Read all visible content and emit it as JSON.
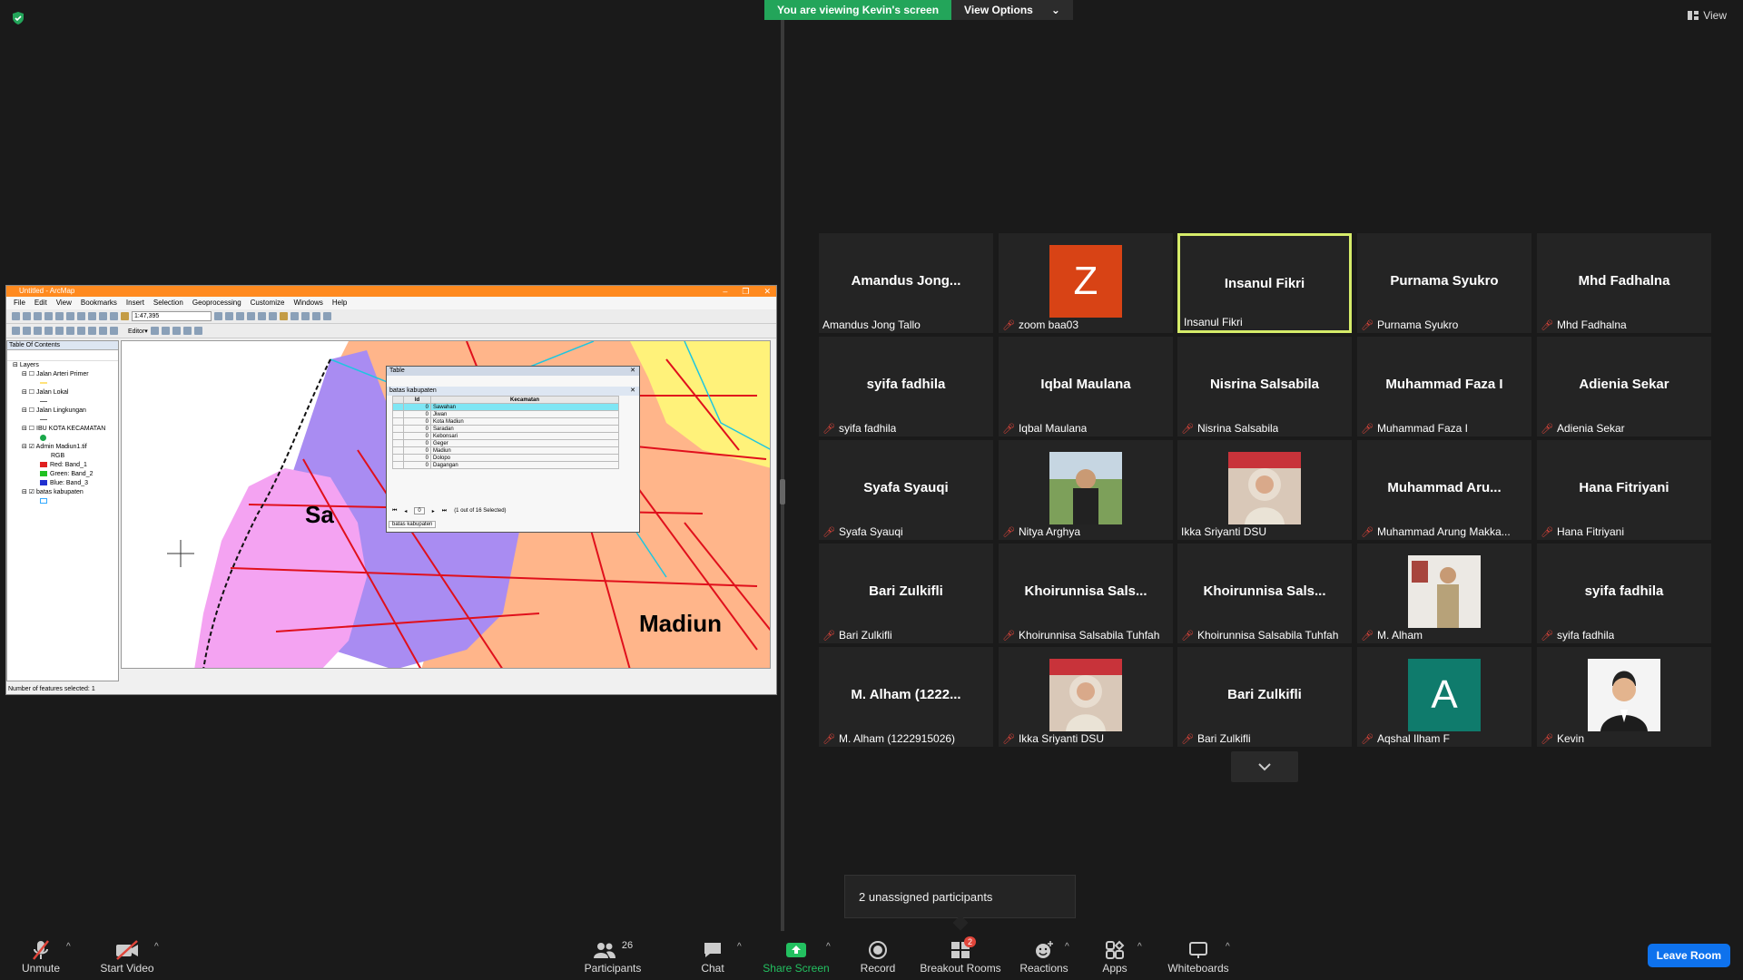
{
  "top": {
    "banner_text": "You are viewing Kevin's screen",
    "view_options": "View Options",
    "view_button": "View"
  },
  "arcmap": {
    "title": "Untitled - ArcMap",
    "menus": [
      "File",
      "Edit",
      "View",
      "Bookmarks",
      "Insert",
      "Selection",
      "Geoprocessing",
      "Customize",
      "Windows",
      "Help"
    ],
    "scale": "1:47,395",
    "editor": "Editor▾",
    "toc_title": "Table Of Contents",
    "toc": [
      "Layers",
      "Jalan Arteri Primer",
      "Jalan Lokal",
      "Jalan Lingkungan",
      "IBU KOTA KECAMATAN",
      "Admin Madiun1.tif",
      "RGB",
      "Red:   Band_1",
      "Green: Band_2",
      "Blue:  Band_3",
      "batas kabupaten"
    ],
    "map_labels": [
      "Sa",
      "Madiun"
    ],
    "status": "Number of features selected: 1",
    "table": {
      "title": "Table",
      "layer": "batas kabupaten",
      "headers": [
        "Id",
        "Kecamatan"
      ],
      "rows": [
        {
          "id": "0",
          "name": "Sawahan"
        },
        {
          "id": "0",
          "name": "Jiwan"
        },
        {
          "id": "0",
          "name": "Kota Madiun"
        },
        {
          "id": "0",
          "name": "Saradan"
        },
        {
          "id": "0",
          "name": "Kebonsari"
        },
        {
          "id": "0",
          "name": "Geger"
        },
        {
          "id": "0",
          "name": "Madiun"
        },
        {
          "id": "0",
          "name": "Dolopo"
        },
        {
          "id": "0",
          "name": "Dagangan"
        }
      ],
      "page_value": "0",
      "selection": "(1 out of 16 Selected)",
      "tab": "batas kabupaten"
    }
  },
  "participants": [
    {
      "big": "Amandus  Jong...",
      "name": "Amandus Jong Tallo",
      "muted": false,
      "type": "name"
    },
    {
      "big": "Z",
      "name": "zoom baa03",
      "muted": true,
      "type": "avatar",
      "color": "#d84315"
    },
    {
      "big": "Insanul Fikri",
      "name": "Insanul Fikri",
      "muted": false,
      "type": "name",
      "active": true
    },
    {
      "big": "Purnama Syukro",
      "name": "Purnama Syukro",
      "muted": true,
      "type": "name"
    },
    {
      "big": "Mhd Fadhalna",
      "name": "Mhd Fadhalna",
      "muted": true,
      "type": "name"
    },
    {
      "big": "syifa fadhila",
      "name": "syifa fadhila",
      "muted": true,
      "type": "name"
    },
    {
      "big": "Iqbal Maulana",
      "name": "Iqbal Maulana",
      "muted": true,
      "type": "name"
    },
    {
      "big": "Nisrina Salsabila",
      "name": "Nisrina Salsabila",
      "muted": true,
      "type": "name"
    },
    {
      "big": "Muhammad Faza I",
      "name": "Muhammad Faza I",
      "muted": true,
      "type": "name"
    },
    {
      "big": "Adienia Sekar",
      "name": "Adienia Sekar",
      "muted": true,
      "type": "name"
    },
    {
      "big": "Syafa Syauqi",
      "name": "Syafa Syauqi",
      "muted": true,
      "type": "name"
    },
    {
      "big": "",
      "name": "Nitya Arghya",
      "muted": true,
      "type": "photo",
      "photo": "outdoor"
    },
    {
      "big": "",
      "name": "Ikka Sriyanti DSU",
      "muted": false,
      "type": "photo",
      "photo": "hijab"
    },
    {
      "big": "Muhammad  Aru...",
      "name": "Muhammad Arung Makka...",
      "muted": true,
      "type": "name"
    },
    {
      "big": "Hana Fitriyani",
      "name": "Hana Fitriyani",
      "muted": true,
      "type": "name"
    },
    {
      "big": "Bari Zulkifli",
      "name": "Bari Zulkifli",
      "muted": true,
      "type": "name"
    },
    {
      "big": "Khoirunnisa  Sals...",
      "name": "Khoirunnisa Salsabila Tuhfah",
      "muted": true,
      "type": "name"
    },
    {
      "big": "Khoirunnisa  Sals...",
      "name": "Khoirunnisa Salsabila Tuhfah",
      "muted": true,
      "type": "name"
    },
    {
      "big": "",
      "name": "M. Alham",
      "muted": true,
      "type": "photo",
      "photo": "room"
    },
    {
      "big": "syifa fadhila",
      "name": "syifa fadhila",
      "muted": true,
      "type": "name"
    },
    {
      "big": "M. Alham  (1222...",
      "name": "M. Alham (1222915026)",
      "muted": true,
      "type": "name"
    },
    {
      "big": "",
      "name": "Ikka Sriyanti DSU",
      "muted": true,
      "type": "photo",
      "photo": "hijab"
    },
    {
      "big": "Bari Zulkifli",
      "name": "Bari Zulkifli",
      "muted": true,
      "type": "name"
    },
    {
      "big": "A",
      "name": "Aqshal Ilham F",
      "muted": true,
      "type": "avatar",
      "color": "#0f7b6c"
    },
    {
      "big": "",
      "name": "Kevin",
      "muted": true,
      "type": "photo",
      "photo": "portrait"
    }
  ],
  "unassigned": "2 unassigned participants",
  "toolbar": {
    "unmute": "Unmute",
    "start_video": "Start Video",
    "participants": "Participants",
    "participants_count": "26",
    "chat": "Chat",
    "share_screen": "Share Screen",
    "record": "Record",
    "breakout": "Breakout Rooms",
    "breakout_badge": "2",
    "reactions": "Reactions",
    "apps": "Apps",
    "whiteboards": "Whiteboards",
    "leave": "Leave Room"
  },
  "colors": {
    "accent_green": "#23a55a",
    "active_border": "#d6ec6a",
    "leave_blue": "#0e72ed",
    "mute_red": "#e0453a"
  }
}
